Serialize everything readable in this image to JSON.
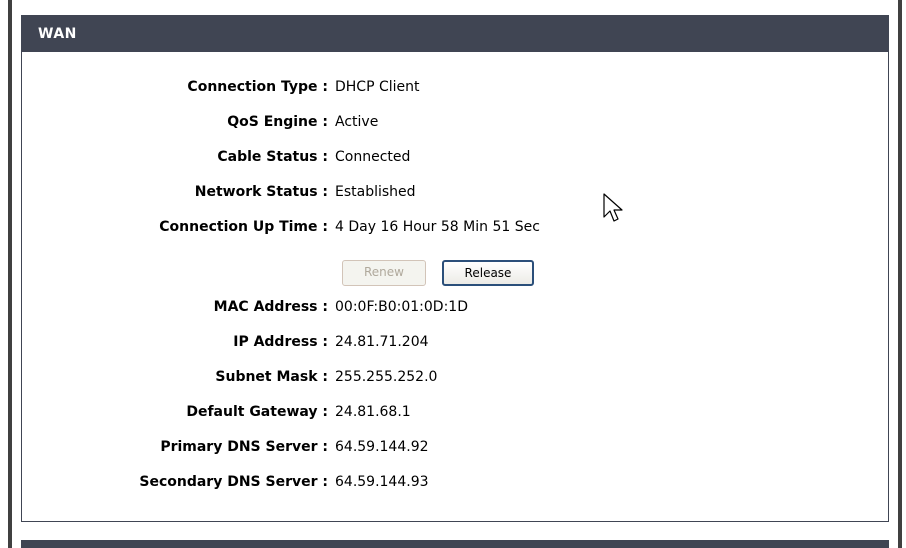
{
  "wan": {
    "title": "WAN",
    "fields": [
      {
        "label": "Connection Type :",
        "value": "DHCP Client"
      },
      {
        "label": "QoS Engine :",
        "value": "Active"
      },
      {
        "label": "Cable Status :",
        "value": "Connected"
      },
      {
        "label": "Network Status :",
        "value": "Established"
      },
      {
        "label": "Connection Up Time :",
        "value": "4 Day 16 Hour 58 Min 51 Sec"
      }
    ],
    "buttons": {
      "renew": "Renew",
      "release": "Release"
    },
    "fields2": [
      {
        "label": "MAC Address :",
        "value": "00:0F:B0:01:0D:1D"
      },
      {
        "label": "IP Address :",
        "value": "24.81.71.204"
      },
      {
        "label": "Subnet Mask :",
        "value": "255.255.252.0"
      },
      {
        "label": "Default Gateway :",
        "value": "24.81.68.1"
      },
      {
        "label": "Primary DNS Server :",
        "value": "64.59.144.92"
      },
      {
        "label": "Secondary DNS Server :",
        "value": "64.59.144.93"
      }
    ]
  },
  "colors": {
    "header_bg": "#404553",
    "header_text": "#ffffff",
    "release_border": "#2b4f7a"
  },
  "icons": {
    "pointer": "mouse-pointer-icon"
  }
}
